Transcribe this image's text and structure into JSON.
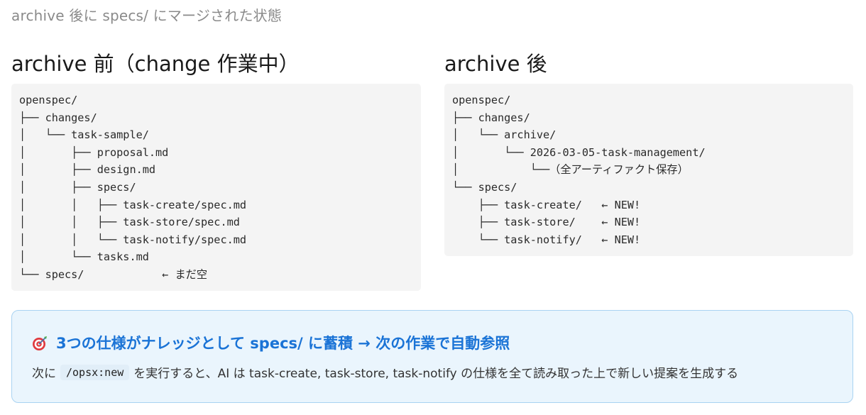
{
  "subtitle": "archive 後に specs/ にマージされた状態",
  "left": {
    "title": "archive 前（change 作業中）",
    "lines": [
      "openspec/",
      "├── changes/",
      "│   └── task-sample/",
      "│       ├── proposal.md",
      "│       ├── design.md",
      "│       ├── specs/",
      "│       │   ├── task-create/spec.md",
      "│       │   ├── task-store/spec.md",
      "│       │   └── task-notify/spec.md",
      "│       └── tasks.md",
      "└── specs/            ← まだ空"
    ]
  },
  "right": {
    "title": "archive 後",
    "lines": [
      "openspec/",
      "├── changes/",
      "│   └── archive/",
      "│       └── 2026-03-05-task-management/",
      "│           └──（全アーティファクト保存）",
      "└── specs/",
      "    ├── task-create/   ← NEW!",
      "    ├── task-store/    ← NEW!",
      "    └── task-notify/   ← NEW!"
    ]
  },
  "callout": {
    "icon": "target-icon",
    "heading": "3つの仕様がナレッジとして specs/ に蓄積 → 次の作業で自動参照",
    "body_prefix": "次に",
    "command": "/opsx:new",
    "body_suffix": "を実行すると、AI は task-create, task-store, task-notify の仕様を全て読み取った上で新しい提案を生成する",
    "colors": {
      "heading": "#1a73d6",
      "background": "#eaf5fd",
      "border": "#a9d3f2"
    }
  }
}
